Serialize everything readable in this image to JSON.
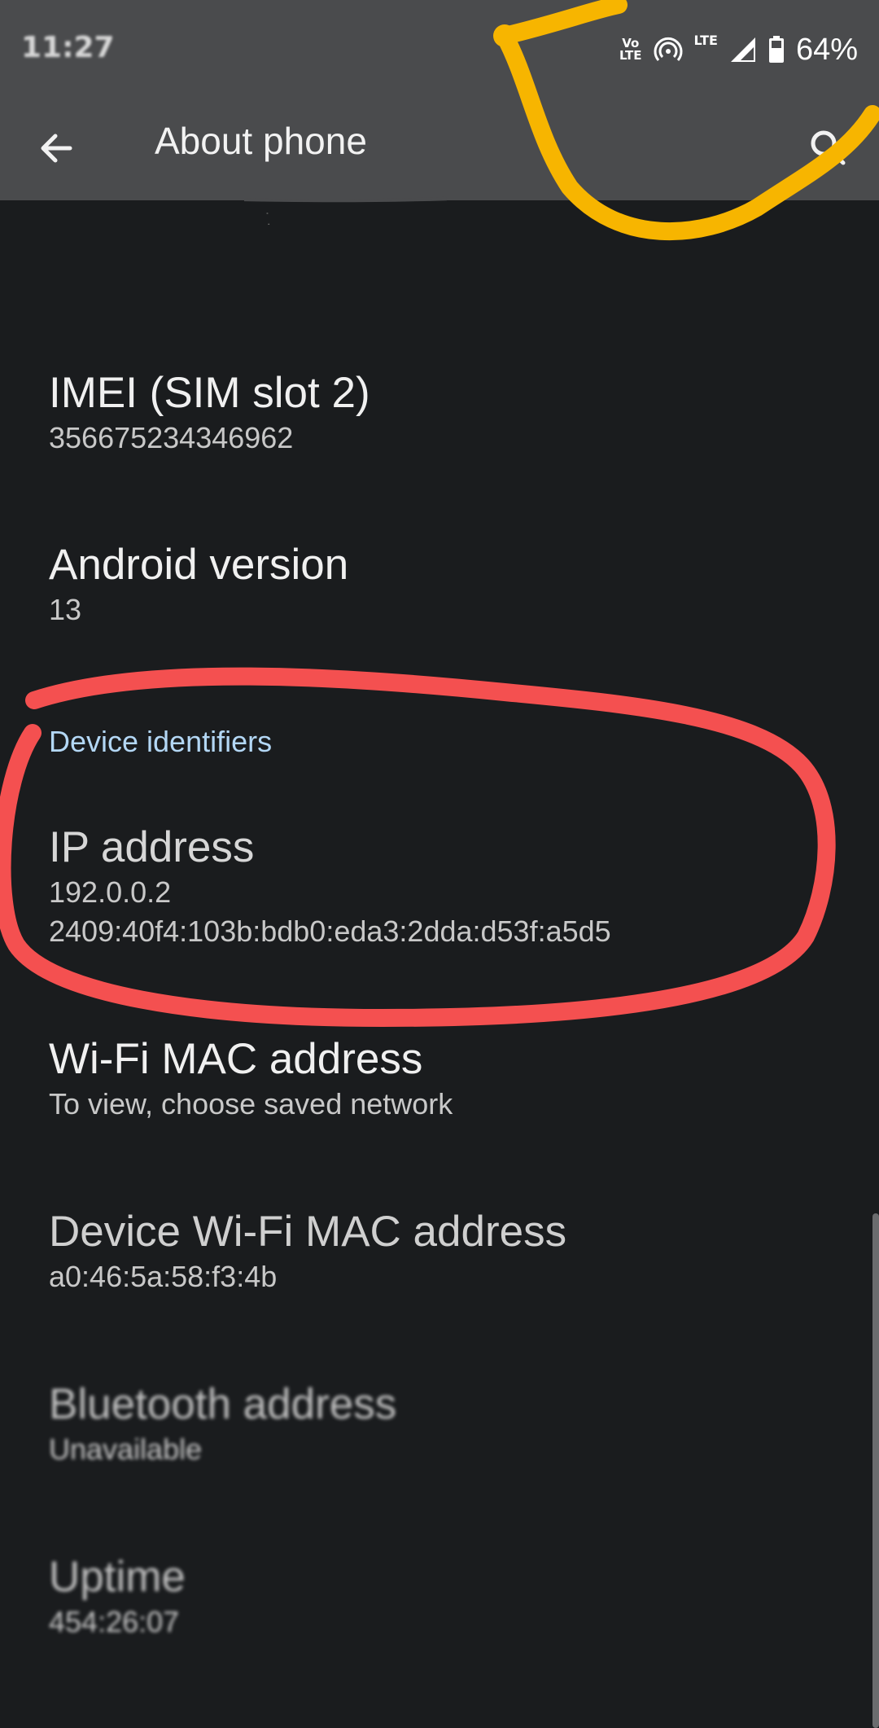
{
  "status_bar": {
    "time": "11:27",
    "volte_top": "Vo",
    "volte_bottom": "LTE",
    "network": "LTE",
    "battery": "64%"
  },
  "app_bar": {
    "title": "About phone",
    "back_icon": "arrow-back-icon",
    "search_icon": "search-icon"
  },
  "items": [
    {
      "title": "IMEI (SIM slot 2)",
      "value": "356675234346962"
    },
    {
      "title": "Android version",
      "value": "13"
    }
  ],
  "section": {
    "header": "Device identifiers"
  },
  "identifiers": [
    {
      "title": "IP address",
      "value": "192.0.0.2",
      "value2": "2409:40f4:103b:bdb0:eda3:2dda:d53f:a5d5"
    },
    {
      "title": "Wi-Fi MAC address",
      "value": "To view, choose saved network"
    },
    {
      "title": "Device Wi-Fi MAC address",
      "value": "a0:46:5a:58:f3:4b"
    },
    {
      "title": "Bluetooth address",
      "value": "Unavailable"
    },
    {
      "title": "Uptime",
      "value": "454:26:07"
    }
  ],
  "colors": {
    "background": "#1a1c1e",
    "app_bar": "#4a4b4d",
    "section_header": "#b3d7f5",
    "annotation_yellow": "#f7b500",
    "annotation_red": "#f45050"
  }
}
